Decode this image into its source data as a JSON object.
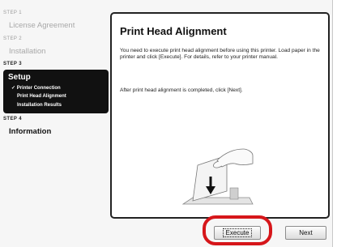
{
  "sidebar": {
    "steps": [
      {
        "number": "STEP 1",
        "title": "License Agreement"
      },
      {
        "number": "STEP 2",
        "title": "Installation"
      },
      {
        "number": "STEP 3",
        "title": "Setup",
        "sub_items": [
          "✓ Printer Connection",
          "Print Head Alignment",
          "Installation Results"
        ]
      },
      {
        "number": "STEP 4",
        "title": "Information"
      }
    ]
  },
  "content": {
    "title": "Print Head Alignment",
    "paragraph1": "You need to execute print head alignment before using this printer. Load paper in the printer and click [Execute]. For details, refer to your printer manual.",
    "paragraph2": "After print head alignment is completed, click [Next]."
  },
  "buttons": {
    "execute": "Execute",
    "next": "Next"
  },
  "colors": {
    "highlight": "#d6161a",
    "active_step_bg": "#111111"
  },
  "icons": {
    "illustration": "paper-loading-hand-illustration",
    "down_arrow": "down-arrow-icon"
  }
}
